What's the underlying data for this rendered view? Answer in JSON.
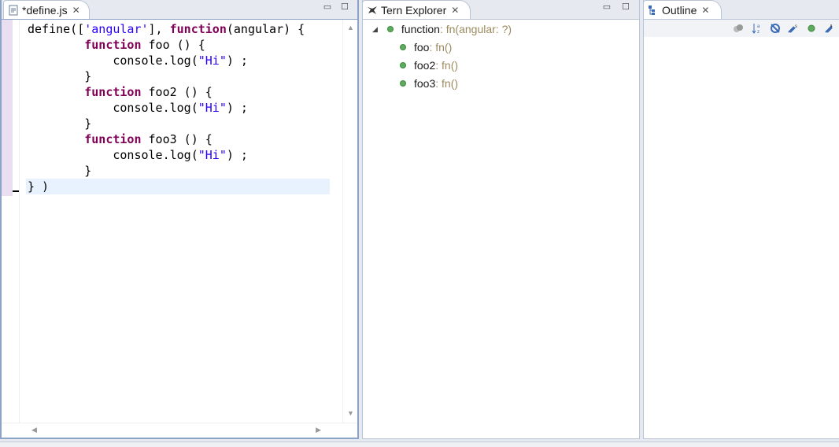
{
  "editor": {
    "tab_title": "*define.js",
    "close_glyph": "✕",
    "lines": [
      {
        "parts": [
          {
            "t": "define(["
          },
          {
            "t": "'angular'",
            "c": "str"
          },
          {
            "t": "], "
          },
          {
            "t": "function",
            "c": "kw"
          },
          {
            "t": "(angular) {"
          }
        ]
      },
      {
        "parts": [
          {
            "t": "        "
          },
          {
            "t": "function",
            "c": "kw"
          },
          {
            "t": " foo () {"
          }
        ]
      },
      {
        "parts": [
          {
            "t": "            console.log("
          },
          {
            "t": "\"Hi\"",
            "c": "str"
          },
          {
            "t": ") ;"
          }
        ]
      },
      {
        "parts": [
          {
            "t": "        }"
          }
        ]
      },
      {
        "parts": [
          {
            "t": "        "
          },
          {
            "t": "function",
            "c": "kw"
          },
          {
            "t": " foo2 () {"
          }
        ]
      },
      {
        "parts": [
          {
            "t": "            console.log("
          },
          {
            "t": "\"Hi\"",
            "c": "str"
          },
          {
            "t": ") ;"
          }
        ]
      },
      {
        "parts": [
          {
            "t": "        }"
          }
        ]
      },
      {
        "parts": [
          {
            "t": "        "
          },
          {
            "t": "function",
            "c": "kw"
          },
          {
            "t": " foo3 () {"
          }
        ]
      },
      {
        "parts": [
          {
            "t": "            console.log("
          },
          {
            "t": "\"Hi\"",
            "c": "str"
          },
          {
            "t": ") ;"
          }
        ]
      },
      {
        "parts": [
          {
            "t": "        }"
          }
        ]
      },
      {
        "parts": [
          {
            "t": "} )"
          }
        ],
        "current": true
      }
    ]
  },
  "tern": {
    "tab_title": "Tern Explorer",
    "close_glyph": "✕",
    "root": {
      "name": "function",
      "type": " : fn(angular: ?)"
    },
    "children": [
      {
        "name": "foo",
        "type": " : fn()"
      },
      {
        "name": "foo2",
        "type": " : fn()"
      },
      {
        "name": "foo3",
        "type": " : fn()"
      }
    ]
  },
  "outline": {
    "tab_title": "Outline",
    "close_glyph": "✕",
    "toolbar_icons": [
      "hide-fields-icon",
      "sort-az-icon",
      "hide-static-icon",
      "hide-nonpublic-icon",
      "hide-local-icon",
      "link-icon"
    ]
  },
  "window_controls": {
    "minimize": "▭",
    "maximize": "☐"
  },
  "colors": {
    "keyword": "#7f0055",
    "string": "#2a00ff",
    "type_hint": "#9b8a5e",
    "node_dot": "#5eaa5e",
    "active_border": "#8aa3c7"
  }
}
